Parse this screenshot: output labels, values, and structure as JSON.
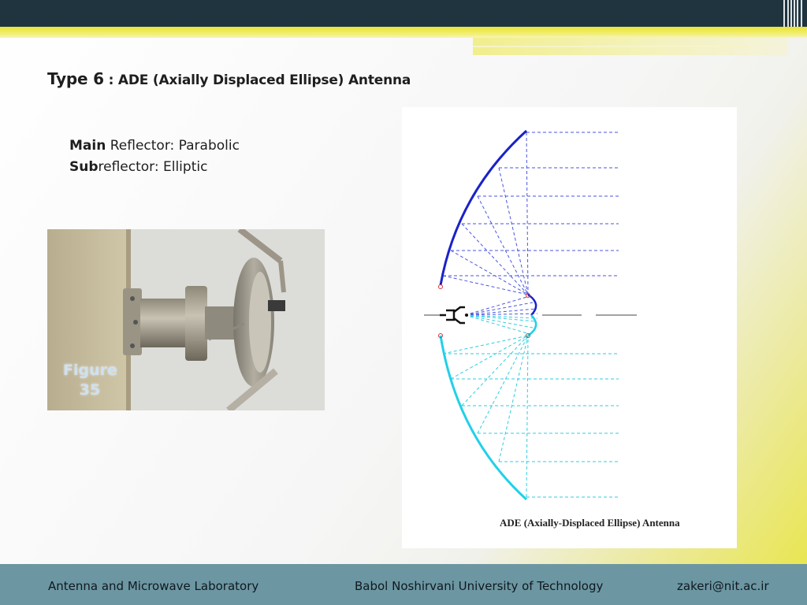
{
  "slide": {
    "title_prefix": "Type 6",
    "title_rest": " : ADE (Axially Displaced Ellipse) Antenna",
    "main_reflector": {
      "label_bold": "Main",
      "label_rest": " Reflector:  Parabolic"
    },
    "subreflector": {
      "label_bold": "Sub",
      "label_rest": "reflector:  Elliptic"
    }
  },
  "photo": {
    "figure_label": "Figure",
    "figure_number": "35"
  },
  "diagram": {
    "caption": "ADE (Axially-Displaced Ellipse) Antenna"
  },
  "footer": {
    "left": "Antenna and Microwave Laboratory",
    "center": "Babol Noshirvani University of Technology",
    "right": "zakeri@nit.ac.ir"
  },
  "colors": {
    "top_bar": "#20343f",
    "accent_yellow": "#e8e336",
    "footer": "#6c97a2",
    "upper_reflector": "#1a22c8",
    "lower_reflector": "#22d0e8"
  }
}
